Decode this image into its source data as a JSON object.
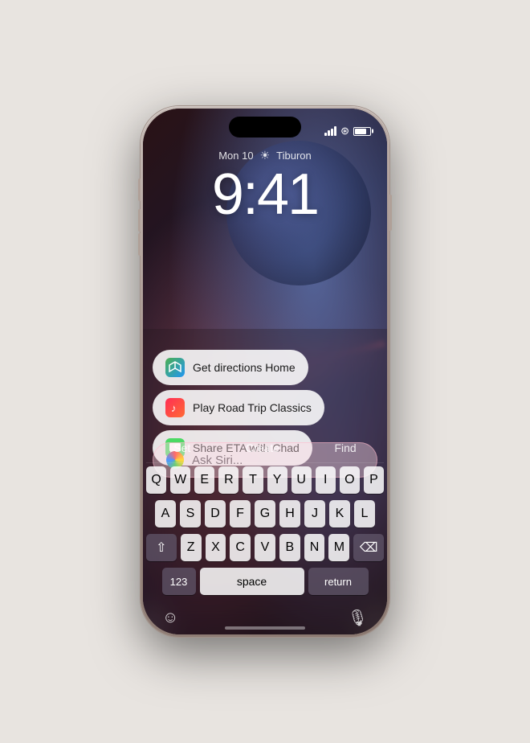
{
  "phone": {
    "status": {
      "time": "",
      "location": "Tiburon",
      "day": "Mon 10"
    },
    "clock": {
      "time": "9:41"
    },
    "suggestions": [
      {
        "id": "directions",
        "icon": "maps-icon",
        "iconEmoji": "🗺",
        "text": "Get directions Home"
      },
      {
        "id": "music",
        "icon": "music-icon",
        "iconEmoji": "♪",
        "text": "Play Road Trip Classics"
      },
      {
        "id": "messages",
        "icon": "messages-icon",
        "iconEmoji": "💬",
        "text": "Share ETA with Chad"
      }
    ],
    "siri": {
      "placeholder": "Ask Siri..."
    },
    "keyboard": {
      "suggestions": [
        "Set",
        "Create",
        "Find"
      ],
      "rows": [
        [
          "Q",
          "W",
          "E",
          "R",
          "T",
          "Y",
          "U",
          "I",
          "O",
          "P"
        ],
        [
          "A",
          "S",
          "D",
          "F",
          "G",
          "H",
          "J",
          "K",
          "L"
        ],
        [
          "⇧",
          "Z",
          "X",
          "C",
          "V",
          "B",
          "N",
          "M",
          "⌫"
        ],
        [
          "123",
          "space",
          "return"
        ]
      ]
    }
  }
}
